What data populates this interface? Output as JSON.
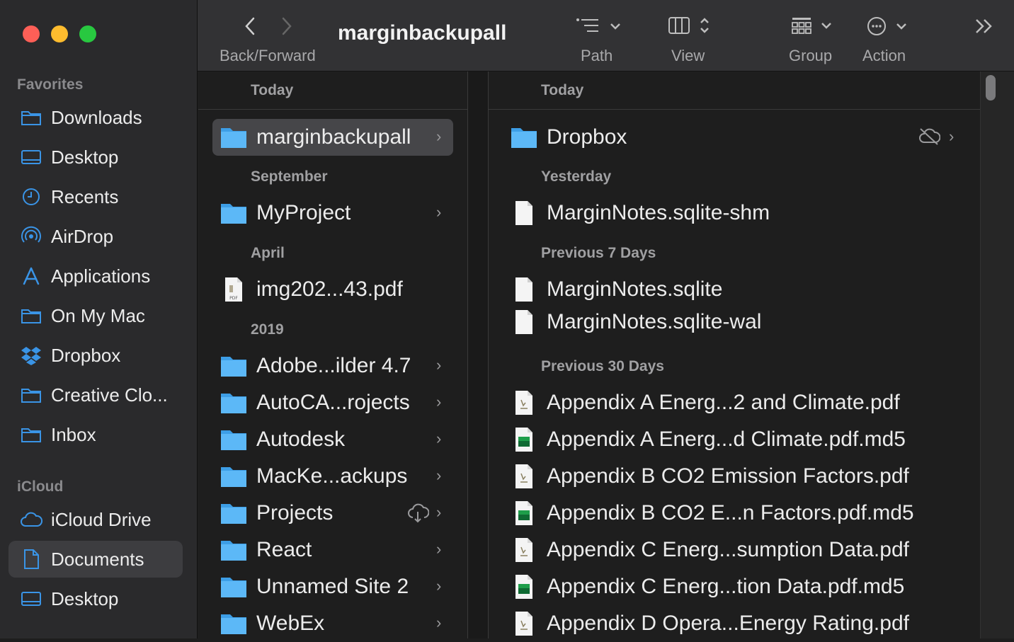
{
  "window": {
    "title": "marginbackupall"
  },
  "toolbar": {
    "back_forward_label": "Back/Forward",
    "path_label": "Path",
    "view_label": "View",
    "group_label": "Group",
    "action_label": "Action"
  },
  "sidebar": {
    "favorites_header": "Favorites",
    "favorites": [
      {
        "label": "Downloads",
        "icon": "folder-icon"
      },
      {
        "label": "Desktop",
        "icon": "desktop-icon"
      },
      {
        "label": "Recents",
        "icon": "clock-icon"
      },
      {
        "label": "AirDrop",
        "icon": "airdrop-icon"
      },
      {
        "label": "Applications",
        "icon": "applications-icon"
      },
      {
        "label": "On My Mac",
        "icon": "folder-icon"
      },
      {
        "label": "Dropbox",
        "icon": "dropbox-icon"
      },
      {
        "label": "Creative Clo...",
        "icon": "folder-icon"
      },
      {
        "label": "Inbox",
        "icon": "folder-icon"
      }
    ],
    "icloud_header": "iCloud",
    "icloud": [
      {
        "label": "iCloud Drive",
        "icon": "cloud-icon"
      },
      {
        "label": "Documents",
        "icon": "document-icon",
        "selected": true
      },
      {
        "label": "Desktop",
        "icon": "desktop-icon"
      }
    ]
  },
  "column1": {
    "groups": [
      {
        "header": "Today",
        "items": [
          {
            "name": "marginbackupall",
            "type": "folder",
            "selected": true
          }
        ]
      },
      {
        "header": "September",
        "items": [
          {
            "name": "MyProject",
            "type": "folder"
          }
        ]
      },
      {
        "header": "April",
        "items": [
          {
            "name": "img202...43.pdf",
            "type": "pdf"
          }
        ]
      },
      {
        "header": "2019",
        "items": [
          {
            "name": "Adobe...ilder 4.7",
            "type": "folder"
          },
          {
            "name": "AutoCA...rojects",
            "type": "folder"
          },
          {
            "name": "Autodesk",
            "type": "folder"
          },
          {
            "name": "MacKe...ackups",
            "type": "folder"
          },
          {
            "name": "Projects",
            "type": "folder",
            "cloud": true
          },
          {
            "name": "React",
            "type": "folder"
          },
          {
            "name": "Unnamed Site 2",
            "type": "folder"
          },
          {
            "name": "WebEx",
            "type": "folder"
          }
        ]
      }
    ]
  },
  "column2": {
    "groups": [
      {
        "header": "Today",
        "items": [
          {
            "name": "Dropbox",
            "type": "folder",
            "cloud_off": true
          }
        ]
      },
      {
        "header": "Yesterday",
        "items": [
          {
            "name": "MarginNotes.sqlite-shm",
            "type": "file"
          }
        ]
      },
      {
        "header": "Previous 7 Days",
        "items": [
          {
            "name": "MarginNotes.sqlite",
            "type": "file"
          },
          {
            "name": "MarginNotes.sqlite-wal",
            "type": "file"
          }
        ]
      },
      {
        "header": "Previous 30 Days",
        "items": [
          {
            "name": "Appendix A  Energ...2 and Climate.pdf",
            "type": "pdf"
          },
          {
            "name": "Appendix A  Energ...d Climate.pdf.md5",
            "type": "md5"
          },
          {
            "name": "Appendix B CO2 Emission Factors.pdf",
            "type": "pdf"
          },
          {
            "name": "Appendix B CO2 E...n Factors.pdf.md5",
            "type": "md5"
          },
          {
            "name": "Appendix C Energ...sumption Data.pdf",
            "type": "pdf"
          },
          {
            "name": "Appendix C Energ...tion Data.pdf.md5",
            "type": "md5"
          },
          {
            "name": "Appendix D  Opera...Energy Rating.pdf",
            "type": "pdf"
          }
        ]
      }
    ]
  },
  "colors": {
    "accent": "#3a94e6",
    "folder": "#4fb3f6",
    "sidebar_bg": "#2a2a2c",
    "window_bg": "#1e1e1e"
  }
}
